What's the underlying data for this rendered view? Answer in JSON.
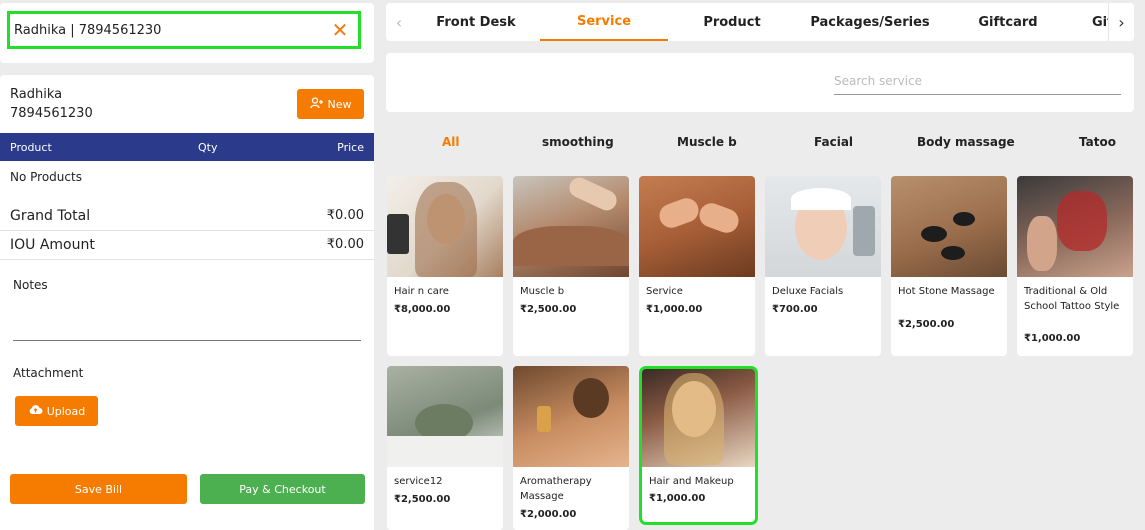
{
  "search": {
    "value": "Radhika | 7894561230"
  },
  "customer": {
    "name": "Radhika",
    "phone": "7894561230"
  },
  "buttons": {
    "new": "New",
    "upload": "Upload",
    "save_bill": "Save Bill",
    "pay_checkout": "Pay & Checkout"
  },
  "cart_table": {
    "headers": [
      "Product",
      "Qty",
      "Price"
    ],
    "empty_text": "No Products"
  },
  "totals": {
    "grand_total_label": "Grand Total",
    "grand_total": "₹0.00",
    "iou_label": "IOU Amount",
    "iou": "₹0.00"
  },
  "notes_label": "Notes",
  "attachment_label": "Attachment",
  "tabs": [
    "Front Desk",
    "Service",
    "Product",
    "Packages/Series",
    "Giftcard",
    "Gif"
  ],
  "active_tab": "Service",
  "service_search": {
    "placeholder": "Search service"
  },
  "categories": [
    "All",
    "smoothing",
    "Muscle b",
    "Facial",
    "Body massage",
    "Tatoo"
  ],
  "active_category": "All",
  "services": [
    {
      "name": "Hair n care",
      "price": "₹8,000.00"
    },
    {
      "name": "Muscle b",
      "price": "₹2,500.00"
    },
    {
      "name": "Service",
      "price": "₹1,000.00"
    },
    {
      "name": "Deluxe Facials",
      "price": "₹700.00"
    },
    {
      "name": "Hot Stone Massage",
      "price": "₹2,500.00"
    },
    {
      "name": "Traditional & Old School Tattoo Style",
      "price": "₹1,000.00"
    },
    {
      "name": "service12",
      "price": "₹2,500.00"
    },
    {
      "name": "Aromatherapy Massage",
      "price": "₹2,000.00"
    },
    {
      "name": "Hair and Makeup",
      "price": "₹1,000.00"
    }
  ],
  "colors": {
    "accent": "#f57c00",
    "table_header": "#2b3a8b",
    "checkout": "#4caf50",
    "highlight": "#22e02a"
  }
}
